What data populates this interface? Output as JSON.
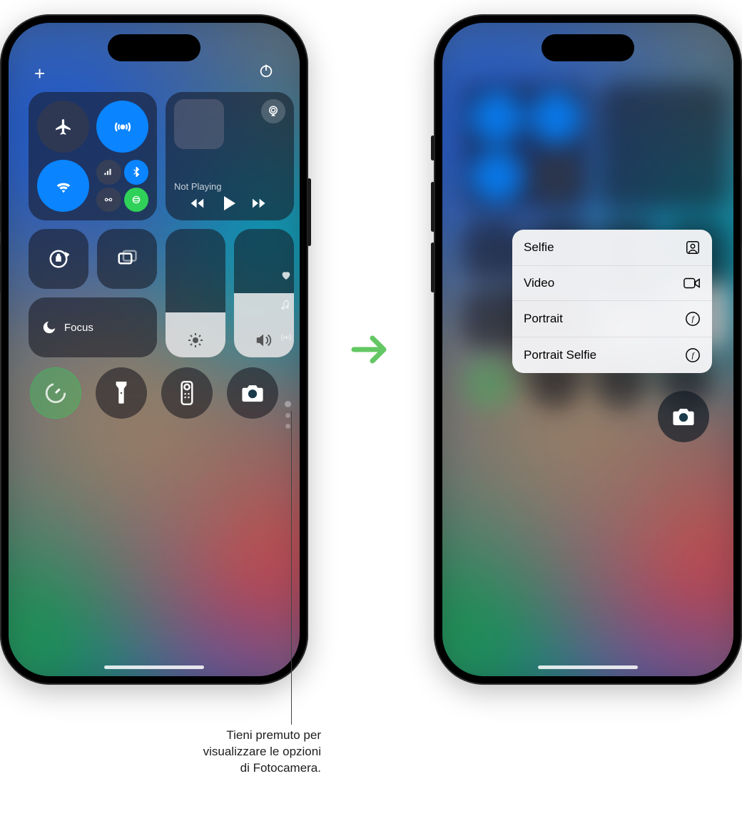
{
  "top_bar": {
    "add_icon": "+",
    "power_icon": "⏻"
  },
  "connectivity": {
    "airplane": {
      "on": false,
      "name": "airplane-mode"
    },
    "airdrop": {
      "on": true,
      "name": "airdrop"
    },
    "wifi": {
      "on": true,
      "name": "wifi"
    },
    "cluster": {
      "cellular": {
        "on": true,
        "name": "cellular"
      },
      "bluetooth": {
        "on": true,
        "name": "bluetooth"
      },
      "hotspot": {
        "on": false,
        "name": "personal-hotspot"
      },
      "satellite": {
        "on": true,
        "name": "satellite"
      }
    }
  },
  "media": {
    "now_playing_label": "Not Playing",
    "controls": {
      "back": "⏮",
      "play": "▶",
      "forward": "⏭"
    }
  },
  "controls": {
    "orientation_lock": "Orientation Lock",
    "screen_mirroring": "Screen Mirroring",
    "focus_label": "Focus",
    "brightness": {
      "level_pct": 35
    },
    "volume": {
      "level_pct": 50
    }
  },
  "side_glyphs": {
    "heart": "♥",
    "music": "♫",
    "antenna": "⸙"
  },
  "shortcut_row": {
    "timer": "Timer",
    "flashlight": "Flashlight",
    "remote": "Apple TV Remote",
    "camera": "Camera"
  },
  "camera_menu": [
    {
      "label": "Selfie",
      "icon": "person-square"
    },
    {
      "label": "Video",
      "icon": "video"
    },
    {
      "label": "Portrait",
      "icon": "f-circle"
    },
    {
      "label": "Portrait Selfie",
      "icon": "f-circle"
    }
  ],
  "callout": {
    "line1": "Tieni premuto per",
    "line2": "visualizzare le opzioni",
    "line3": "di Fotocamera."
  }
}
